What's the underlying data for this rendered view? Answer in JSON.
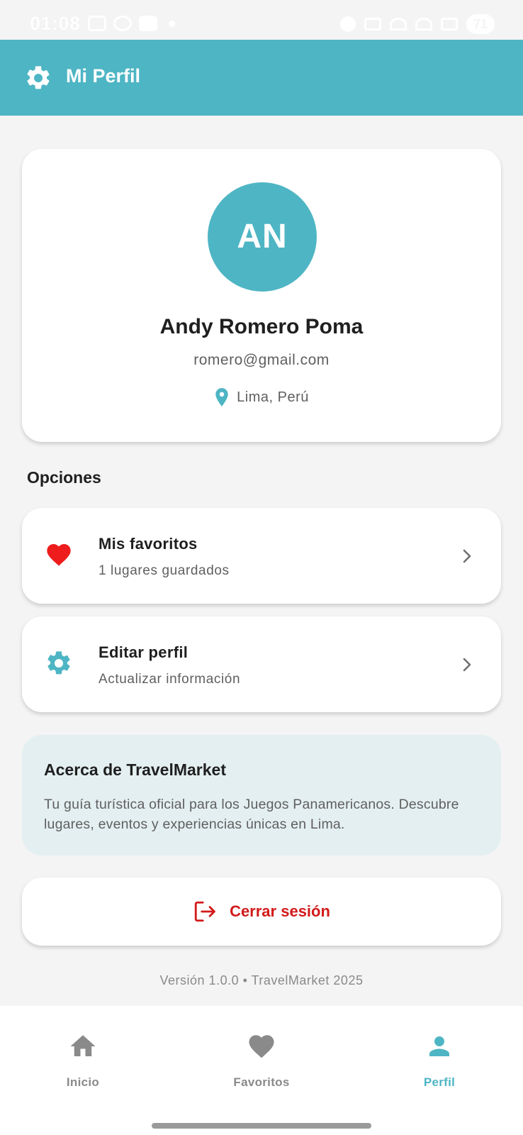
{
  "status_bar": {
    "time": "01:08",
    "battery": "71"
  },
  "header": {
    "title": "Mi Perfil",
    "icon": "gear-icon"
  },
  "profile": {
    "initials": "AN",
    "name": "Andy Romero Poma",
    "email": "romero@gmail.com",
    "location": "Lima, Perú"
  },
  "options": {
    "section_title": "Opciones",
    "items": [
      {
        "title": "Mis favoritos",
        "subtitle": "1 lugares guardados",
        "icon": "heart-icon"
      },
      {
        "title": "Editar perfil",
        "subtitle": "Actualizar información",
        "icon": "gear-icon"
      }
    ]
  },
  "about": {
    "title": "Acerca de TravelMarket",
    "text": "Tu guía turística oficial para los Juegos Panamericanos. Descubre lugares, eventos y experiencias únicas en Lima."
  },
  "logout": {
    "label": "Cerrar sesión",
    "icon": "logout-icon"
  },
  "footer": {
    "version": "Versión 1.0.0 • TravelMarket 2025"
  },
  "bottom_nav": {
    "items": [
      {
        "label": "Inicio",
        "icon": "home-icon",
        "active": false
      },
      {
        "label": "Favoritos",
        "icon": "heart-icon",
        "active": false
      },
      {
        "label": "Perfil",
        "icon": "person-icon",
        "active": true
      }
    ]
  },
  "colors": {
    "primary": "#4eb5c4",
    "danger": "#d21a1a",
    "heart": "#ee1c1c",
    "about_bg": "#e4eff1"
  }
}
